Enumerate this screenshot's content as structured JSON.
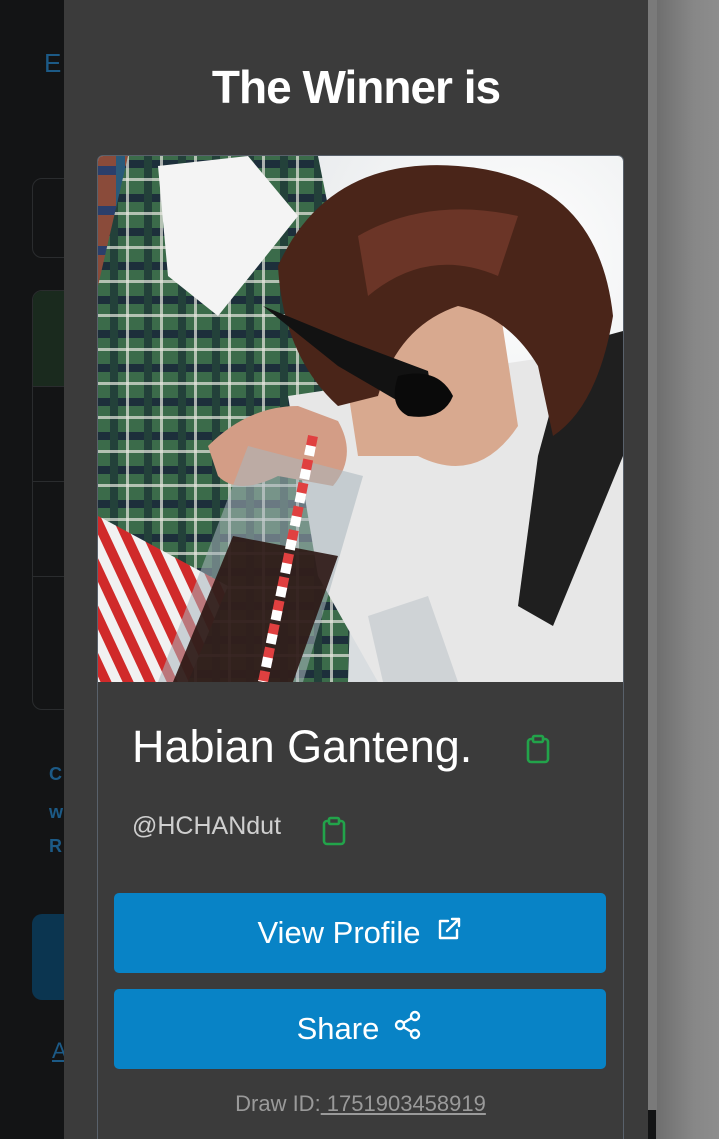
{
  "background": {
    "heading_fragment": "E",
    "side_letters": [
      "C",
      "w",
      "R"
    ],
    "link_fragment": "A"
  },
  "modal": {
    "title": "The Winner is",
    "winner": {
      "photo_alt": "winner-photo",
      "name": "Habian Ganteng.",
      "handle": "@HCHANdut"
    },
    "buttons": {
      "view_profile": "View Profile",
      "share": "Share"
    },
    "draw": {
      "label": "Draw ID:",
      "id": " 1751903458919"
    }
  },
  "icons": {
    "copy_name": "clipboard-icon",
    "copy_handle": "clipboard-icon",
    "view_profile": "external-link-icon",
    "share": "share-icon"
  },
  "colors": {
    "accent": "#0883c6",
    "copy_icon": "#22a34a",
    "modal_bg": "#3b3b3b",
    "page_bg": "#131415"
  }
}
